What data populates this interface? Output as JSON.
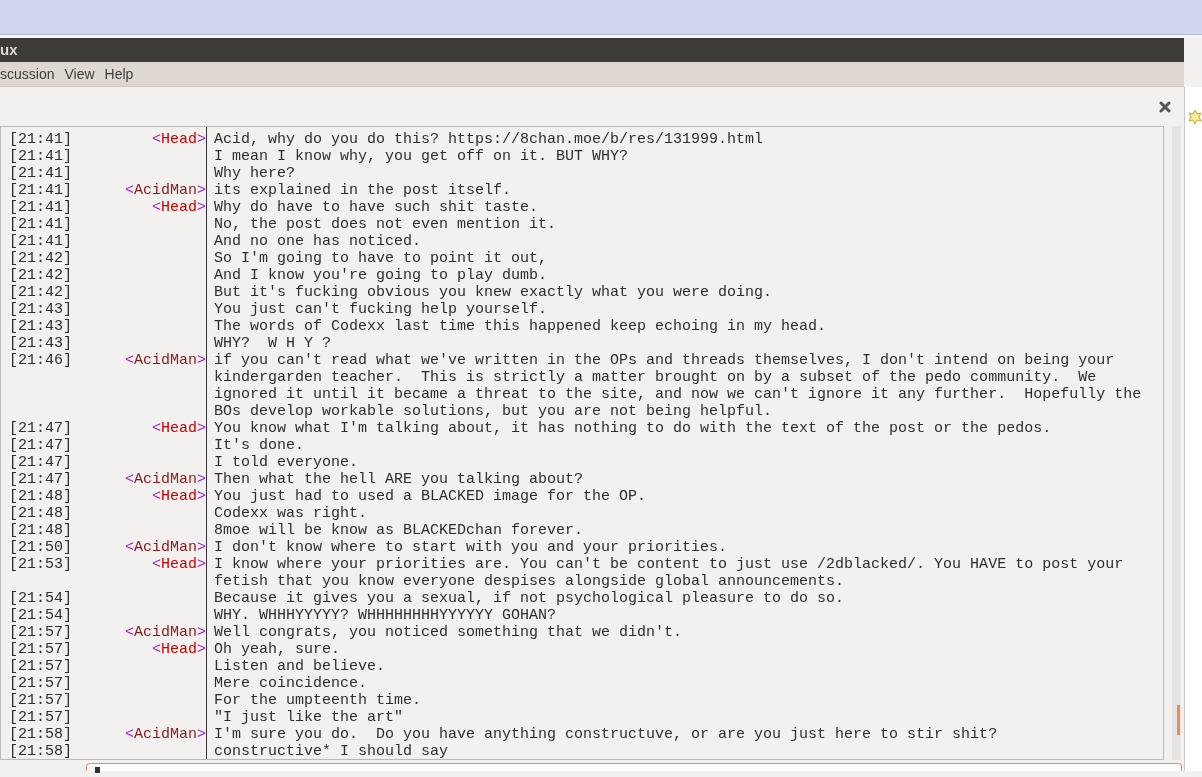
{
  "window": {
    "title": "ux"
  },
  "menu": [
    {
      "label": "scussion"
    },
    {
      "label": "View"
    },
    {
      "label": "Help"
    }
  ],
  "chat": [
    {
      "time": "[21:41]",
      "nick": "<Head>",
      "color": "#cc0000",
      "text": "Acid, why do you do this? https://8chan.moe/b/res/131999.html"
    },
    {
      "time": "[21:41]",
      "text": "I mean I know why, you get off on it. BUT WHY?"
    },
    {
      "time": "[21:41]",
      "text": "Why here?"
    },
    {
      "time": "[21:41]",
      "nick": "<AcidMan>",
      "color": "#8b1a1a",
      "text": "its explained in the post itself."
    },
    {
      "time": "[21:41]",
      "nick": "<Head>",
      "color": "#cc0000",
      "text": "Why do have to have such shit taste."
    },
    {
      "time": "[21:41]",
      "text": "No, the post does not even mention it."
    },
    {
      "time": "[21:41]",
      "text": "And no one has noticed."
    },
    {
      "time": "[21:42]",
      "text": "So I'm going to have to point it out,"
    },
    {
      "time": "[21:42]",
      "text": "And I know you're going to play dumb."
    },
    {
      "time": "[21:42]",
      "text": "But it's fucking obvious you knew exactly what you were doing."
    },
    {
      "time": "[21:43]",
      "text": "You just can't fucking help yourself."
    },
    {
      "time": "[21:43]",
      "text": "The words of Codexx last time this happened keep echoing in my head."
    },
    {
      "time": "[21:43]",
      "text": "WHY?  W H Y ?"
    },
    {
      "time": "[21:46]",
      "nick": "<AcidMan>",
      "color": "#8b1a1a",
      "text": "if you can't read what we've written in the OPs and threads themselves, I don't intend on being your kindergarden teacher.  This is strictly a matter brought on by a subset of the pedo community.  We ignored it until it became a threat to the site, and now we can't ignore it any further.  Hopefully the BOs develop workable solutions, but you are not being helpful."
    },
    {
      "time": "[21:47]",
      "nick": "<Head>",
      "color": "#cc0000",
      "text": "You know what I'm talking about, it has nothing to do with the text of the post or the pedos."
    },
    {
      "time": "[21:47]",
      "text": "It's done."
    },
    {
      "time": "[21:47]",
      "text": "I told everyone."
    },
    {
      "time": "[21:47]",
      "nick": "<AcidMan>",
      "color": "#8b1a1a",
      "text": "Then what the hell ARE you talking about?"
    },
    {
      "time": "[21:48]",
      "nick": "<Head>",
      "color": "#cc0000",
      "text": "You just had to used a BLACKED image for the OP."
    },
    {
      "time": "[21:48]",
      "text": "Codexx was right."
    },
    {
      "time": "[21:48]",
      "text": "8moe will be know as BLACKEDchan forever."
    },
    {
      "time": "[21:50]",
      "nick": "<AcidMan>",
      "color": "#8b1a1a",
      "text": "I don't know where to start with you and your priorities."
    },
    {
      "time": "[21:53]",
      "nick": "<Head>",
      "color": "#cc0000",
      "text": "I know where your priorities are. You can't be content to just use /2dblacked/. You HAVE to post your fetish that you know everyone despises alongside global announcements."
    },
    {
      "time": "[21:54]",
      "text": "Because it gives you a sexual, if not psychological pleasure to do so."
    },
    {
      "time": "[21:54]",
      "text": "WHY. WHHHYYYYY? WHHHHHHHHYYYYYY GOHAN?"
    },
    {
      "time": "[21:57]",
      "nick": "<AcidMan>",
      "color": "#8b1a1a",
      "text": "Well congrats, you noticed something that we didn't."
    },
    {
      "time": "[21:57]",
      "nick": "<Head>",
      "color": "#cc0000",
      "text": "Oh yeah, sure."
    },
    {
      "time": "[21:57]",
      "text": "Listen and believe."
    },
    {
      "time": "[21:57]",
      "text": "Mere coincidence."
    },
    {
      "time": "[21:57]",
      "text": "For the umpteenth time."
    },
    {
      "time": "[21:57]",
      "text": "\"I just like the art\""
    },
    {
      "time": "[21:58]",
      "nick": "<AcidMan>",
      "color": "#8b1a1a",
      "text": "I'm sure you do.  Do you have anything constructuve, or are you just here to stir shit?"
    },
    {
      "time": "[21:58]",
      "text": "constructive* I should say"
    }
  ]
}
